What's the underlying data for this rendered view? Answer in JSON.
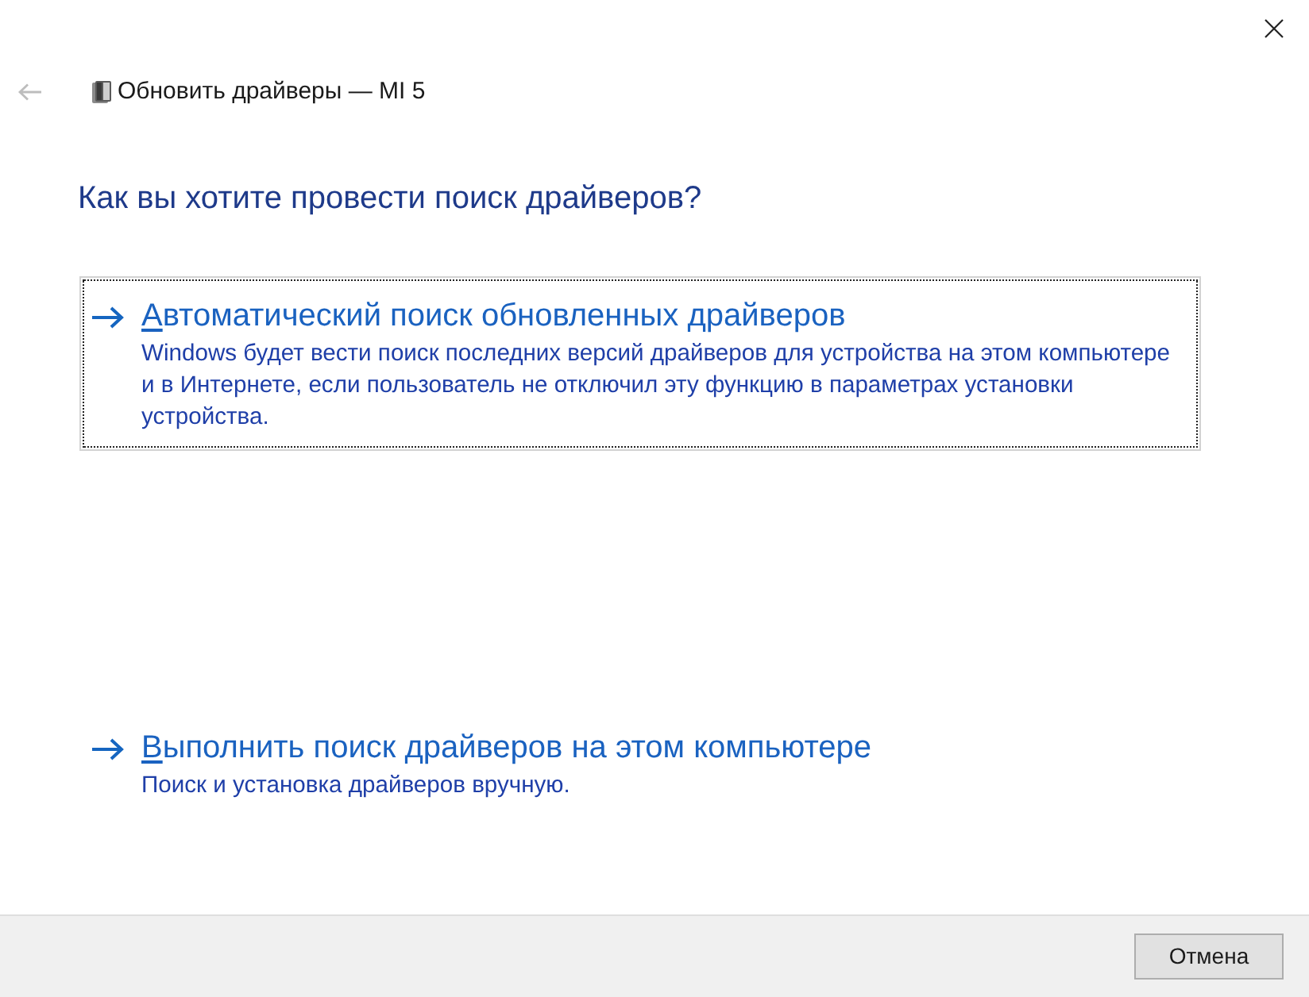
{
  "window": {
    "title": "Обновить драйверы — MI 5"
  },
  "back_button": {
    "disabled": true
  },
  "heading": "Как вы хотите провести поиск драйверов?",
  "options": [
    {
      "title": "Автоматический поиск обновленных драйверов",
      "access_key_underlined": true,
      "description": "Windows будет вести поиск последних версий драйверов для устройства на этом компьютере и в Интернете, если пользователь не отключил эту функцию в параметрах установки устройства.",
      "focused": true
    },
    {
      "title": "Выполнить поиск драйверов на этом компьютере",
      "access_key_underlined": true,
      "description": "Поиск и установка драйверов вручную.",
      "focused": false
    }
  ],
  "buttons": [
    {
      "label": "Отмена"
    }
  ]
}
